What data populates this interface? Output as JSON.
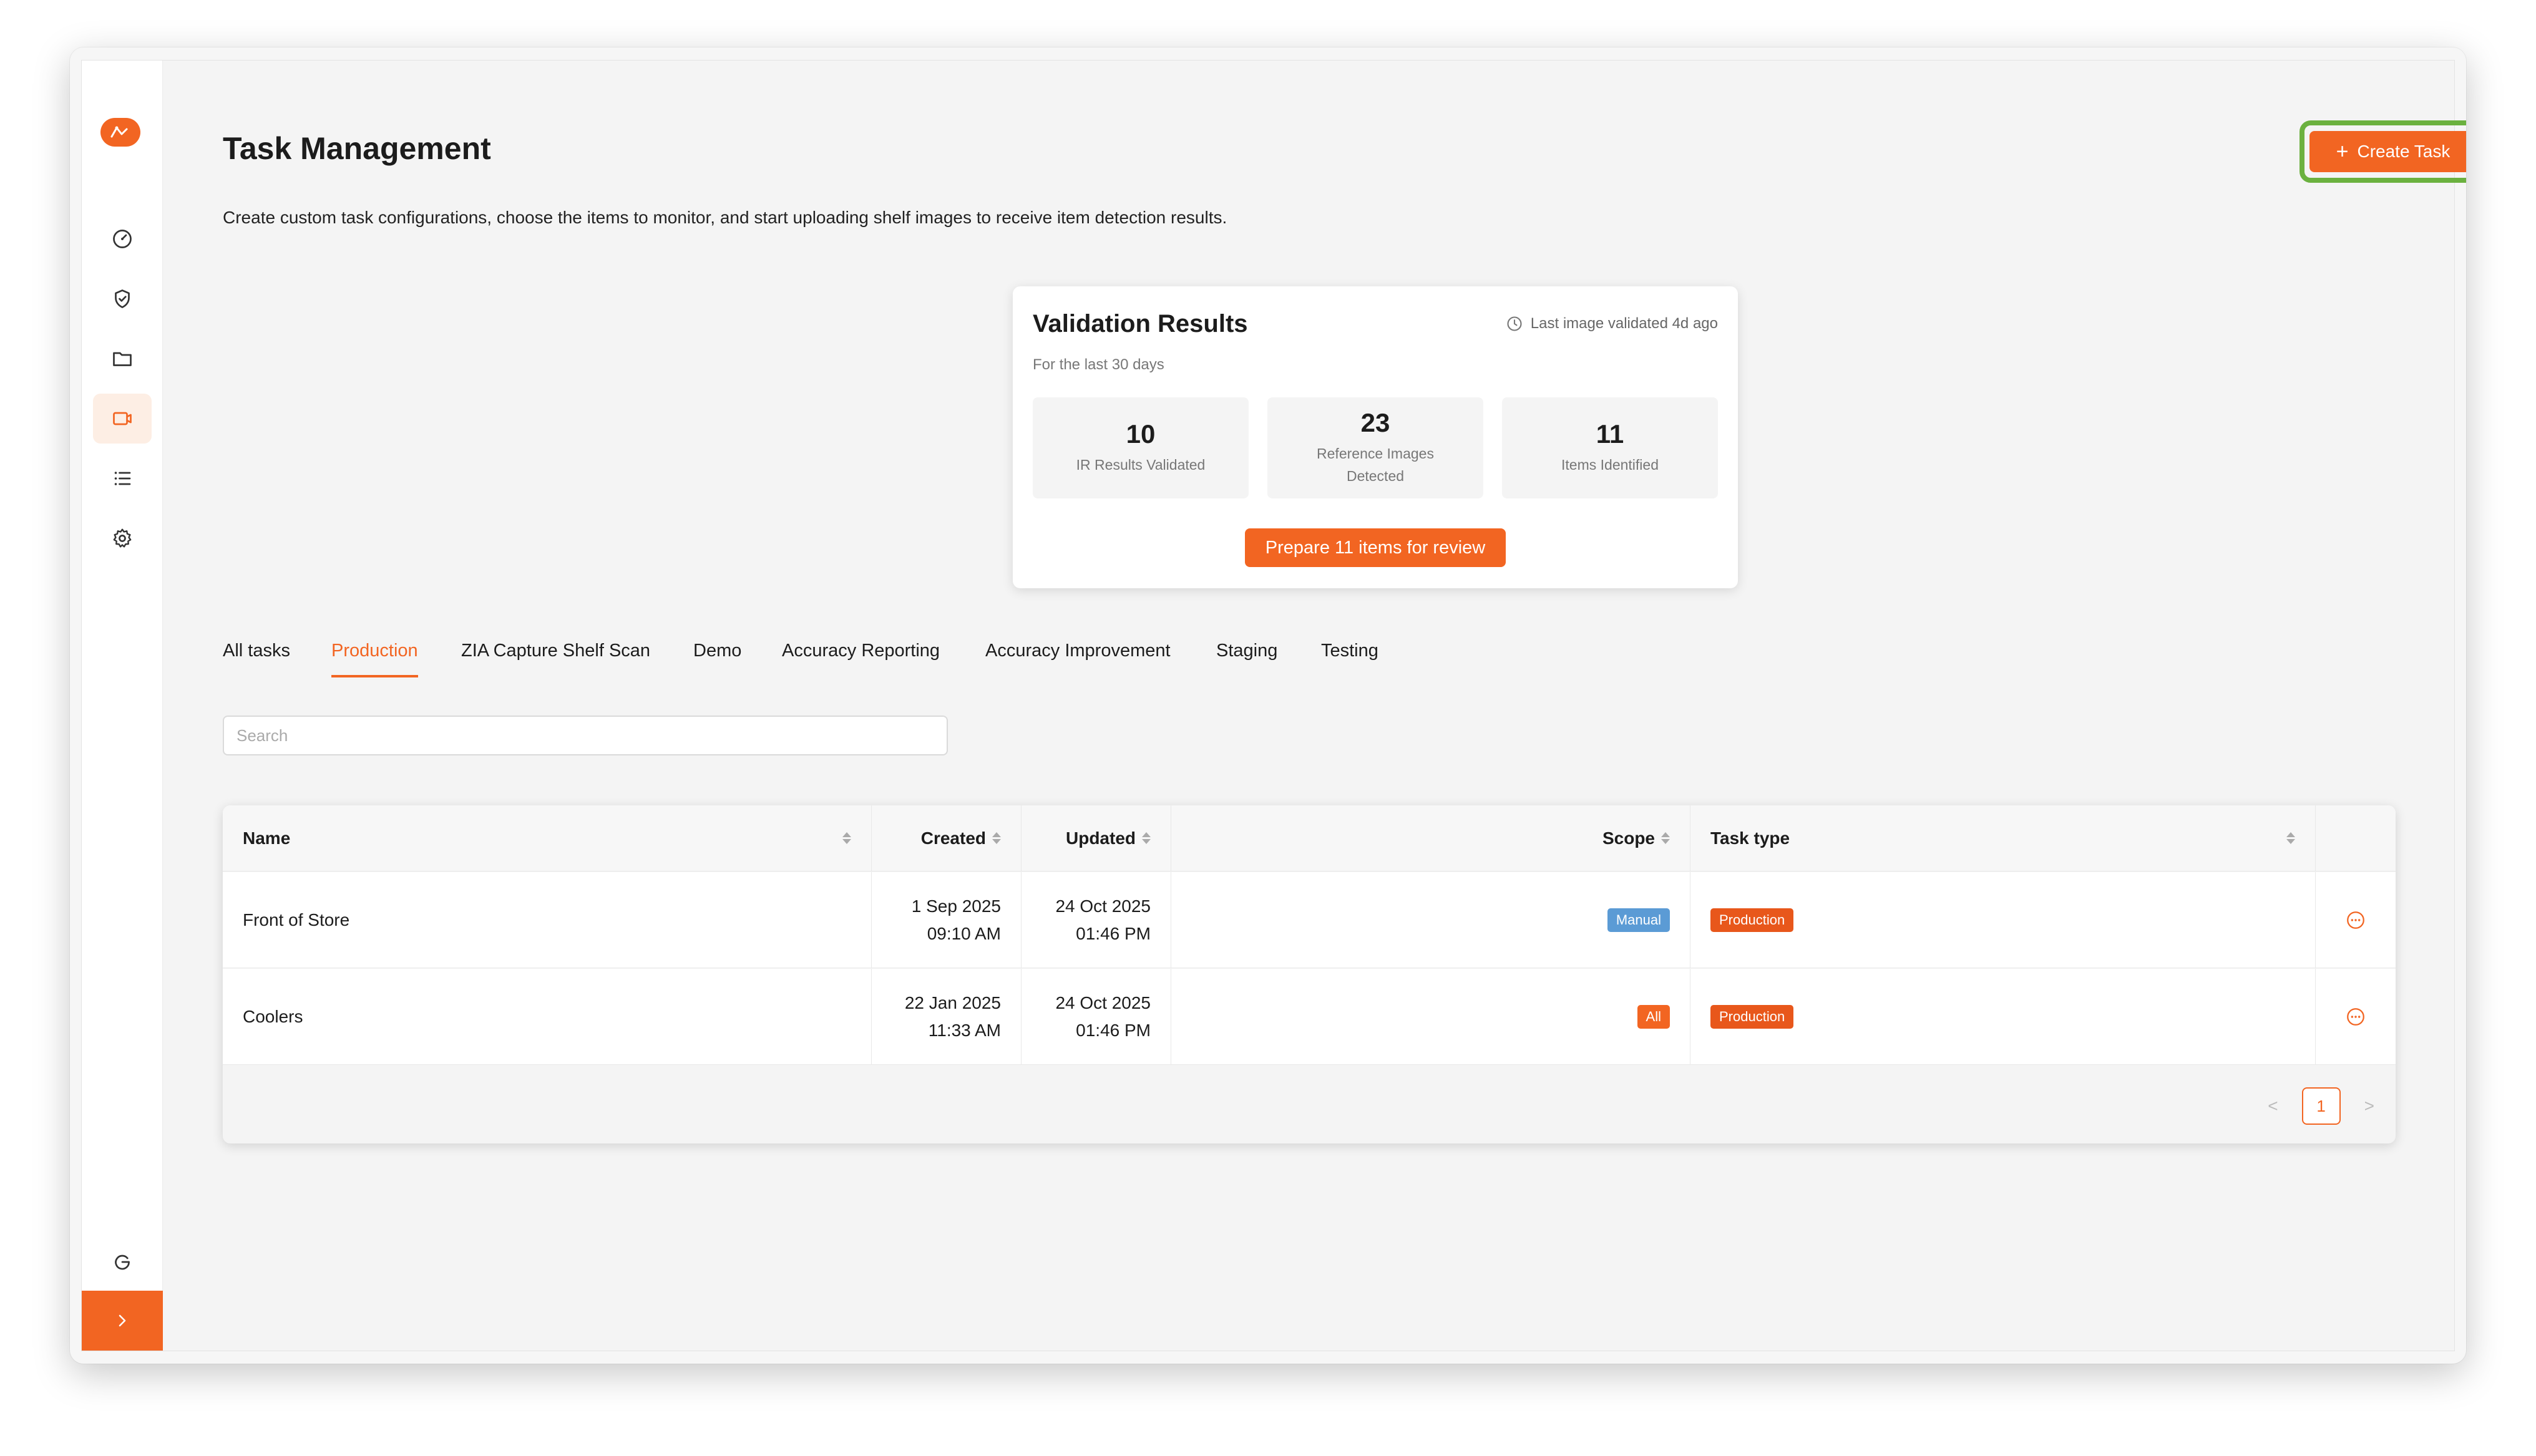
{
  "colors": {
    "accent": "#f26522",
    "highlight": "#6bb13f",
    "scope_manual": "#5b9bd5",
    "scope_all": "#f26522",
    "type_production": "#e8571b"
  },
  "sidebar": {
    "items": [
      {
        "icon": "dashboard-icon"
      },
      {
        "icon": "shield-check-icon"
      },
      {
        "icon": "folder-icon"
      },
      {
        "icon": "tasks-icon",
        "active": true
      },
      {
        "icon": "list-icon"
      },
      {
        "icon": "settings-icon"
      }
    ],
    "bottom_icon": "logout-icon",
    "expand_label": ">"
  },
  "header": {
    "title": "Task Management",
    "description": "Create custom task configurations, choose the items to monitor, and start uploading shelf images to receive item detection results.",
    "create_button": "Create Task",
    "create_button_icon": "+"
  },
  "validation": {
    "title": "Validation Results",
    "subtitle": "For the last 30 days",
    "last_validated": "Last image validated 4d ago",
    "stats": [
      {
        "value": "10",
        "label": "IR Results Validated"
      },
      {
        "value": "23",
        "label": "Reference Images Detected"
      },
      {
        "value": "11",
        "label": "Items Identified"
      }
    ],
    "review_button": "Prepare 11 items for review"
  },
  "tabs": [
    {
      "label": "All tasks"
    },
    {
      "label": "Production",
      "active": true
    },
    {
      "label": "ZIA Capture Shelf Scan"
    },
    {
      "label": "Demo"
    },
    {
      "label": "Accuracy Reporting"
    },
    {
      "label": "Accuracy Improvement"
    },
    {
      "label": "Staging"
    },
    {
      "label": "Testing"
    }
  ],
  "search": {
    "placeholder": "Search",
    "value": ""
  },
  "table": {
    "columns": {
      "name": "Name",
      "created": "Created",
      "updated": "Updated",
      "scope": "Scope",
      "task_type": "Task type"
    },
    "rows": [
      {
        "name": "Front of Store",
        "created_date": "1 Sep 2025",
        "created_time": "09:10 AM",
        "updated_date": "24 Oct 2025",
        "updated_time": "01:46 PM",
        "scope": "Manual",
        "task_type": "Production"
      },
      {
        "name": "Coolers",
        "created_date": "22 Jan 2025",
        "created_time": "11:33 AM",
        "updated_date": "24 Oct 2025",
        "updated_time": "01:46 PM",
        "scope": "All",
        "task_type": "Production"
      }
    ]
  },
  "pagination": {
    "current_page": "1",
    "prev": "<",
    "next": ">"
  }
}
